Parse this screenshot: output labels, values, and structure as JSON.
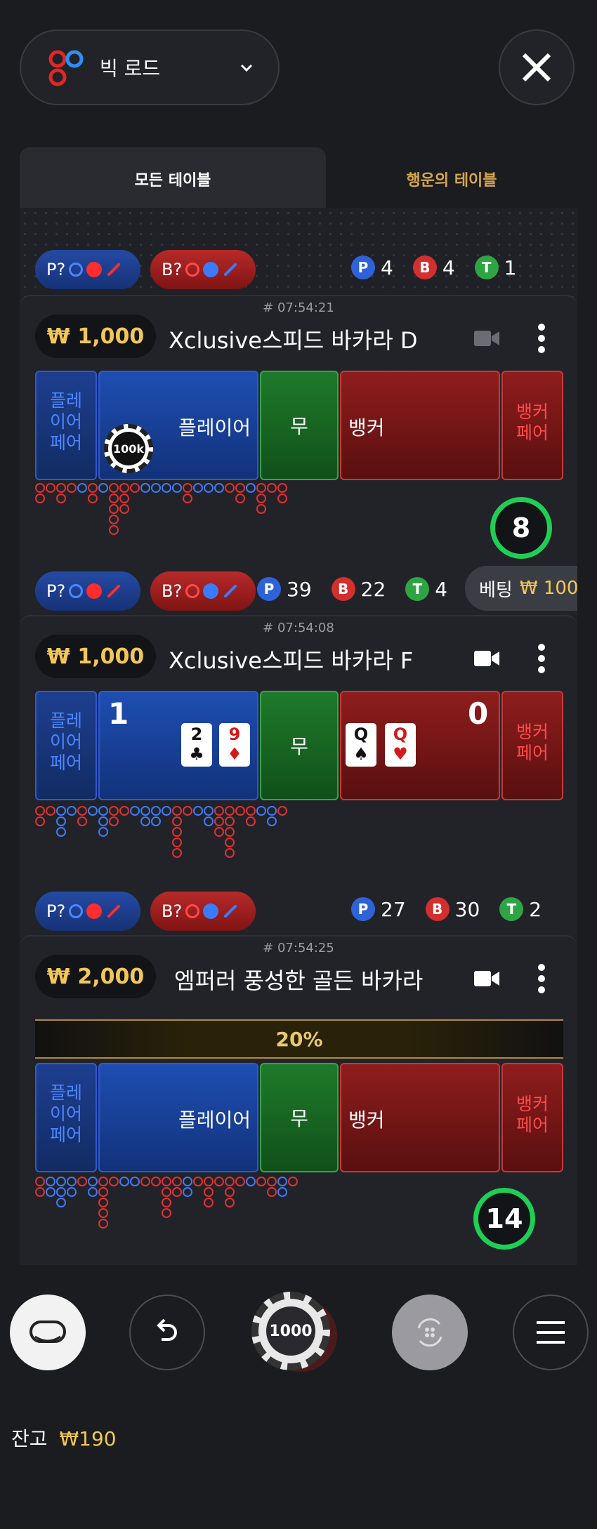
{
  "header": {
    "view_label": "빅 로드"
  },
  "tabs": {
    "all": "모든 테이블",
    "lucky": "행운의 테이블"
  },
  "bet_labels": {
    "player_pair_short": "P?",
    "banker_pair_short": "B?"
  },
  "table_strip_top": {
    "p": "4",
    "b": "4",
    "t": "1"
  },
  "tables": [
    {
      "round": "# 07:54:21",
      "limit": "₩ 1,000",
      "name": "Xclusive스피드 바카라 D",
      "player_pair": "플레\n이어\n페어",
      "player": "플레이어",
      "tie": "무",
      "banker": "뱅커",
      "banker_pair": "뱅커\n페어",
      "chip": "100k",
      "timer": "8",
      "stats": {
        "p": "39",
        "b": "22",
        "t": "4"
      },
      "bet_label": "베팅",
      "bet_amount": "₩ 100"
    },
    {
      "round": "# 07:54:08",
      "limit": "₩ 1,000",
      "name": "Xclusive스피드 바카라 F",
      "player_pair": "플레\n이어\n페어",
      "tie": "무",
      "banker_pair": "뱅커\n페어",
      "player_score": "1",
      "banker_score": "0",
      "player_cards": [
        {
          "rank": "2",
          "suit": "♣"
        },
        {
          "rank": "9",
          "suit": "♦"
        }
      ],
      "banker_cards": [
        {
          "rank": "Q",
          "suit": "♠"
        },
        {
          "rank": "Q",
          "suit": "♥"
        }
      ],
      "stats": {
        "p": "27",
        "b": "30",
        "t": "2"
      }
    },
    {
      "round": "# 07:54:25",
      "limit": "₩ 2,000",
      "name": "엠퍼러 풍성한 골든 바카라",
      "banner": "20%",
      "player_pair": "플레\n이어\n페어",
      "player": "플레이어",
      "tie": "무",
      "banker": "뱅커",
      "banker_pair": "뱅커\n페어",
      "timer": "14"
    }
  ],
  "bottom": {
    "chip_value": "1000",
    "balance_label": "잔고",
    "balance_value": "₩190"
  },
  "colors": {
    "player": "#2e5ad0",
    "banker": "#d22f2f",
    "tie": "#2fa445",
    "gold": "#f3c757"
  },
  "icons": [
    "baccarat-logo-icon",
    "chevron-down-icon",
    "close-icon",
    "video-icon",
    "more-vertical-icon",
    "table-icon",
    "undo-icon",
    "chip-icon",
    "repeat-icon",
    "menu-icon"
  ]
}
